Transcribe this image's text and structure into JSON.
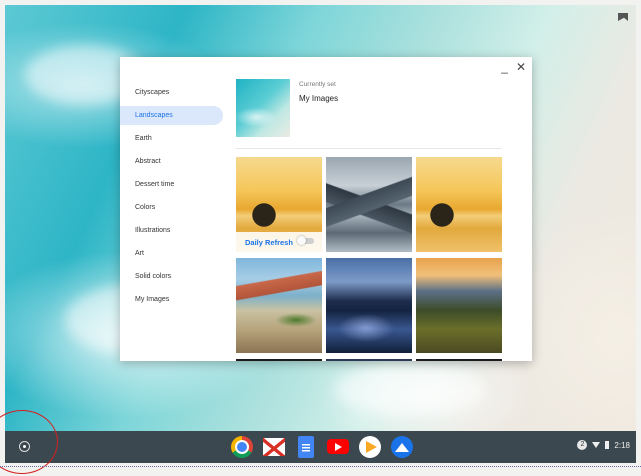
{
  "wallpaper_app": {
    "categories": [
      "Cityscapes",
      "Landscapes",
      "Earth",
      "Abstract",
      "Dessert time",
      "Colors",
      "Illustrations",
      "Art",
      "Solid colors",
      "My Images"
    ],
    "active_category": "Landscapes",
    "current": {
      "label": "Currently set",
      "name": "My Images"
    },
    "daily_refresh_label": "Daily Refresh",
    "daily_refresh_on": false
  },
  "window_controls": {
    "minimize": "_",
    "close": "✕"
  },
  "shelf": {
    "apps": [
      "chrome-icon",
      "gmail-icon",
      "docs-icon",
      "youtube-icon",
      "play-store-icon",
      "photos-icon"
    ],
    "notification_count": "2",
    "time": "2:18"
  }
}
